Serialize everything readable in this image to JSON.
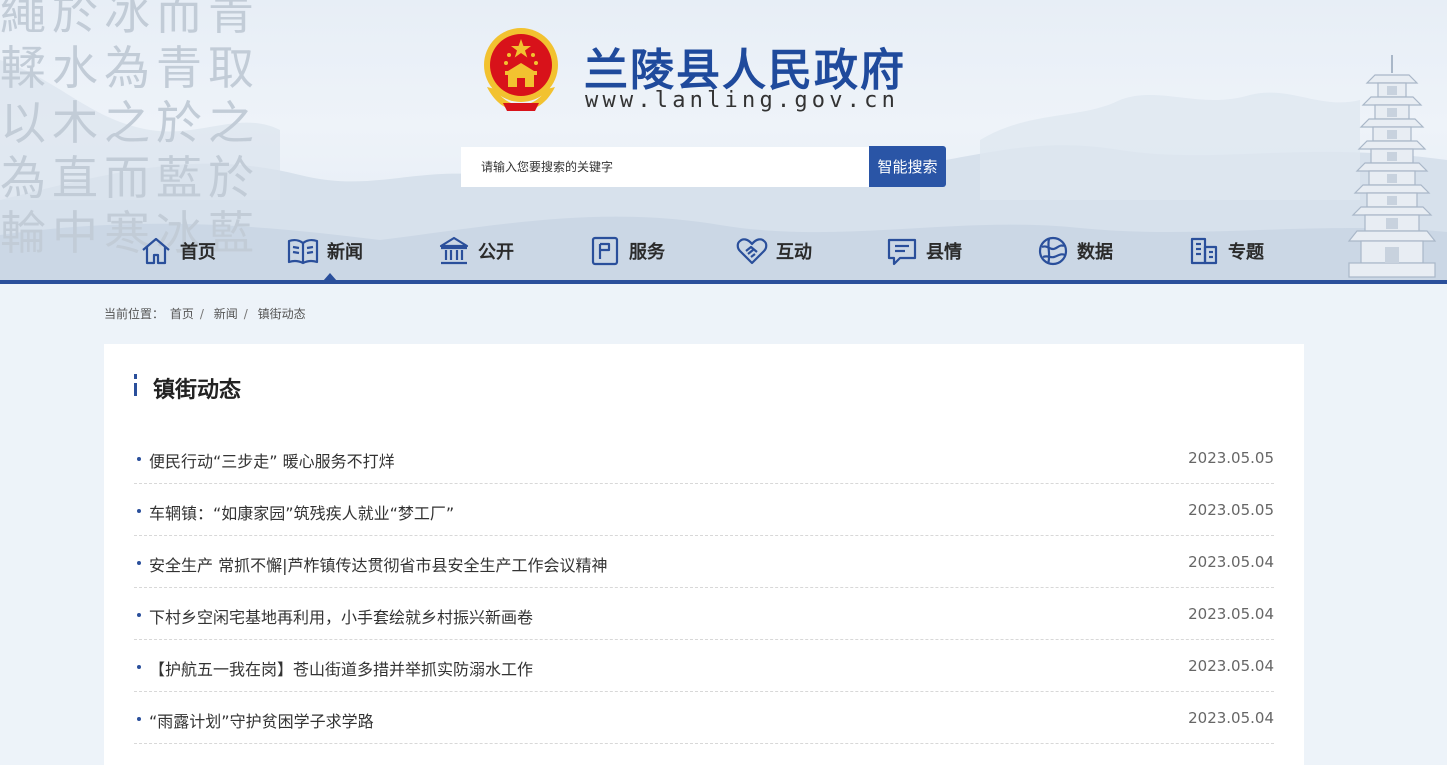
{
  "header": {
    "site_title": "兰陵县人民政府",
    "site_url": "www.lanling.gov.cn",
    "calligraphy_lines": [
      "繩於冰而青",
      "輮水為青取",
      "以木之於之",
      "為直而藍於",
      "輪中寒冰藍"
    ]
  },
  "search": {
    "placeholder": "请输入您要搜索的关键字",
    "button_label": "智能搜索"
  },
  "nav": {
    "items": [
      {
        "label": "首页",
        "icon": "home-icon"
      },
      {
        "label": "新闻",
        "icon": "news-book-icon",
        "active": true
      },
      {
        "label": "公开",
        "icon": "government-building-icon"
      },
      {
        "label": "服务",
        "icon": "service-flag-icon"
      },
      {
        "label": "互动",
        "icon": "handshake-icon"
      },
      {
        "label": "县情",
        "icon": "chat-bubble-icon"
      },
      {
        "label": "数据",
        "icon": "data-globe-icon"
      },
      {
        "label": "专题",
        "icon": "buildings-icon"
      }
    ]
  },
  "breadcrumb": {
    "prefix": "当前位置：",
    "items": [
      "首页",
      "新闻",
      "镇街动态"
    ]
  },
  "panel": {
    "title": "镇街动态",
    "news": [
      {
        "title": "便民行动“三步走” 暖心服务不打烊",
        "date": "2023.05.05"
      },
      {
        "title": "车辋镇：“如康家园”筑残疾人就业“梦工厂”",
        "date": "2023.05.05"
      },
      {
        "title": "安全生产 常抓不懈|芦柞镇传达贯彻省市县安全生产工作会议精神",
        "date": "2023.05.04"
      },
      {
        "title": "下村乡空闲宅基地再利用，小手套绘就乡村振兴新画卷",
        "date": "2023.05.04"
      },
      {
        "title": "【护航五一我在岗】苍山街道多措并举抓实防溺水工作",
        "date": "2023.05.04"
      },
      {
        "title": "“雨露计划”守护贫困学子求学路",
        "date": "2023.05.04"
      }
    ]
  },
  "colors": {
    "brand_blue": "#2a4f9b",
    "title_blue": "#1f4a9c",
    "search_button": "#2a55a6",
    "emblem_red": "#d8121a",
    "emblem_gold": "#f2c230"
  }
}
